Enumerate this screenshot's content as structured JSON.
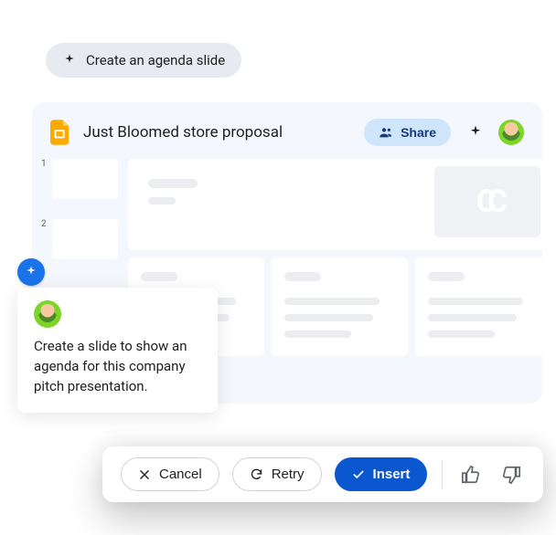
{
  "prompt_chip": {
    "label": "Create an agenda slide"
  },
  "app": {
    "doc_title": "Just Bloomed store proposal",
    "share_label": "Share",
    "thumbnails": [
      {
        "index": "1"
      },
      {
        "index": "2"
      }
    ]
  },
  "callout": {
    "text": "Create a slide to show an agenda for this company pitch presentation."
  },
  "actions": {
    "cancel": "Cancel",
    "retry": "Retry",
    "insert": "Insert"
  },
  "colors": {
    "primary": "#0b57d0",
    "accent": "#1a73e8",
    "share_bg": "#cfe5fb"
  }
}
